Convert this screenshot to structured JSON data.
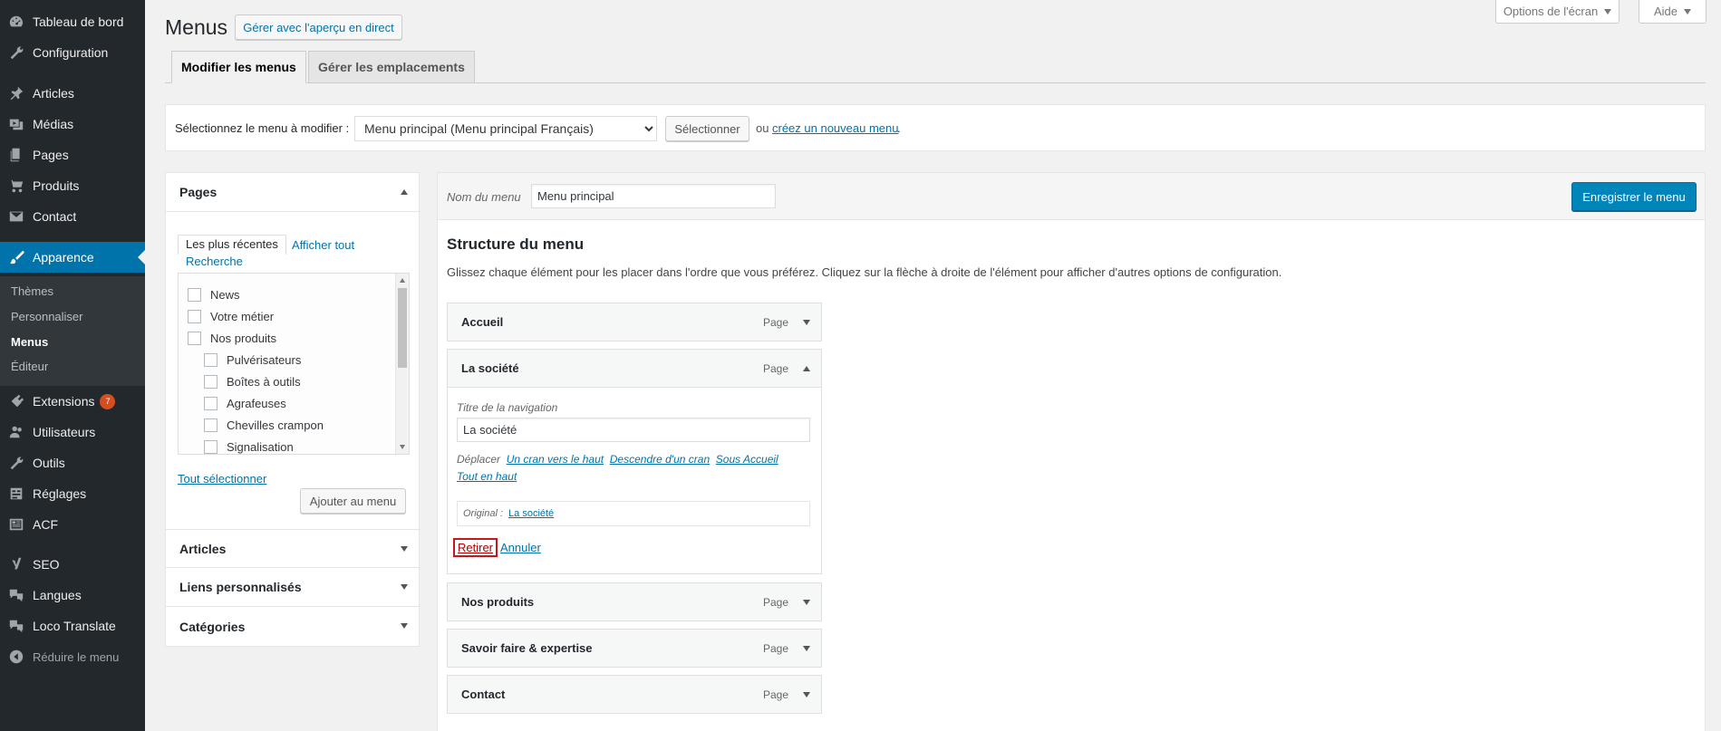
{
  "sidebar": {
    "items": [
      {
        "label": "Tableau de bord",
        "icon": "dashboard-icon"
      },
      {
        "label": "Configuration",
        "icon": "wrench-icon"
      },
      {
        "label": "Articles",
        "icon": "pin-icon"
      },
      {
        "label": "Médias",
        "icon": "media-icon"
      },
      {
        "label": "Pages",
        "icon": "pages-icon"
      },
      {
        "label": "Produits",
        "icon": "cart-icon"
      },
      {
        "label": "Contact",
        "icon": "envelope-icon"
      },
      {
        "label": "Apparence",
        "icon": "brush-icon"
      },
      {
        "label": "Extensions",
        "icon": "plugin-icon",
        "badge": "7"
      },
      {
        "label": "Utilisateurs",
        "icon": "users-icon"
      },
      {
        "label": "Outils",
        "icon": "tools-icon"
      },
      {
        "label": "Réglages",
        "icon": "settings-icon"
      },
      {
        "label": "ACF",
        "icon": "acf-icon"
      },
      {
        "label": "SEO",
        "icon": "yoast-icon"
      },
      {
        "label": "Langues",
        "icon": "translation-icon"
      },
      {
        "label": "Loco Translate",
        "icon": "translation-icon"
      },
      {
        "label": "Réduire le menu",
        "icon": "collapse-icon"
      }
    ],
    "submenu": [
      "Thèmes",
      "Personnaliser",
      "Menus",
      "Éditeur"
    ]
  },
  "header": {
    "title": "Menus",
    "live_preview": "Gérer avec l'aperçu en direct",
    "screen_options": "Options de l'écran",
    "help": "Aide"
  },
  "tabs": [
    "Modifier les menus",
    "Gérer les emplacements"
  ],
  "select_bar": {
    "label": "Sélectionnez le menu à modifier :",
    "selected": "Menu principal (Menu principal Français)",
    "button": "Sélectionner",
    "or": "ou",
    "create_link": "créez un nouveau menu",
    "dot": "."
  },
  "left_panel": {
    "pages_title": "Pages",
    "subtabs": [
      "Les plus récentes",
      "Afficher tout",
      "Recherche"
    ],
    "pages": [
      {
        "label": "News",
        "level": 0
      },
      {
        "label": "Votre métier",
        "level": 0
      },
      {
        "label": "Nos produits",
        "level": 0
      },
      {
        "label": "Pulvérisateurs",
        "level": 1
      },
      {
        "label": "Boîtes à outils",
        "level": 1
      },
      {
        "label": "Agrafeuses",
        "level": 1
      },
      {
        "label": "Chevilles crampon",
        "level": 1
      },
      {
        "label": "Signalisation",
        "level": 1
      }
    ],
    "select_all": "Tout sélectionner",
    "add_button": "Ajouter au menu",
    "sections": [
      "Articles",
      "Liens personnalisés",
      "Catégories"
    ]
  },
  "right_panel": {
    "menu_name_label": "Nom du menu",
    "menu_name_value": "Menu principal",
    "save_button": "Enregistrer le menu",
    "structure_title": "Structure du menu",
    "structure_help": "Glissez chaque élément pour les placer dans l'ordre que vous préférez. Cliquez sur la flèche à droite de l'élément pour afficher d'autres options de configuration.",
    "items": [
      {
        "label": "Accueil",
        "type": "Page"
      },
      {
        "label": "La société",
        "type": "Page"
      },
      {
        "label": "Nos produits",
        "type": "Page"
      },
      {
        "label": "Savoir faire & expertise",
        "type": "Page"
      },
      {
        "label": "Contact",
        "type": "Page"
      }
    ],
    "expanded": {
      "nav_title_label": "Titre de la navigation",
      "nav_title_value": "La société",
      "move_label": "Déplacer",
      "move_links": [
        "Un cran vers le haut",
        "Descendre d'un cran",
        "Sous Accueil",
        "Tout en haut"
      ],
      "original_label": "Original :",
      "original_link": "La société",
      "remove": "Retirer",
      "cancel": "Annuler"
    }
  }
}
